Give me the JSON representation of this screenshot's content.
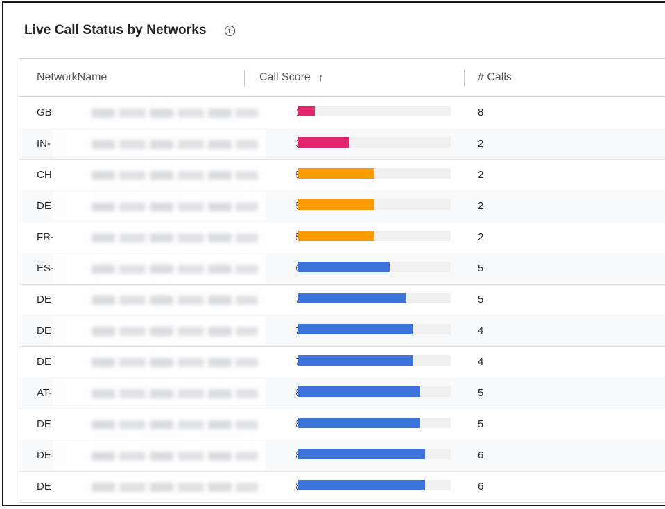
{
  "header": {
    "title": "Live Call Status by Networks",
    "info_icon_glyph": "i"
  },
  "table": {
    "columns": {
      "network": "NetworkName",
      "score": "Call Score",
      "sort_arrow": "↑",
      "calls": "# Calls"
    },
    "score_max": 100,
    "colors": {
      "poor": "#e0266e",
      "fair": "#fb9a00",
      "good": "#3b73db",
      "track": "#f0f0f1"
    },
    "rows": [
      {
        "prefix": "GB",
        "score": "11",
        "score_value": 11,
        "level": "poor",
        "calls": "8"
      },
      {
        "prefix": "IN-",
        "score": "33",
        "score_value": 33,
        "level": "poor",
        "calls": "2"
      },
      {
        "prefix": "CH",
        "score": "50",
        "score_value": 50,
        "level": "fair",
        "calls": "2"
      },
      {
        "prefix": "DE",
        "score": "50",
        "score_value": 50,
        "level": "fair",
        "calls": "2"
      },
      {
        "prefix": "FR-",
        "score": "50",
        "score_value": 50,
        "level": "fair",
        "calls": "2"
      },
      {
        "prefix": "ES-",
        "score": "60",
        "score_value": 60,
        "level": "good",
        "calls": "5"
      },
      {
        "prefix": "DE",
        "score": "71",
        "score_value": 71,
        "level": "good",
        "calls": "5"
      },
      {
        "prefix": "DE",
        "score": "75",
        "score_value": 75,
        "level": "good",
        "calls": "4"
      },
      {
        "prefix": "DE",
        "score": "75",
        "score_value": 75,
        "level": "good",
        "calls": "4"
      },
      {
        "prefix": "AT-",
        "score": "80",
        "score_value": 80,
        "level": "good",
        "calls": "5"
      },
      {
        "prefix": "DE",
        "score": "80",
        "score_value": 80,
        "level": "good",
        "calls": "5"
      },
      {
        "prefix": "DE",
        "score": "83",
        "score_value": 83,
        "level": "good",
        "calls": "6"
      },
      {
        "prefix": "DE",
        "score": "83",
        "score_value": 83,
        "level": "good",
        "calls": "6"
      }
    ]
  }
}
